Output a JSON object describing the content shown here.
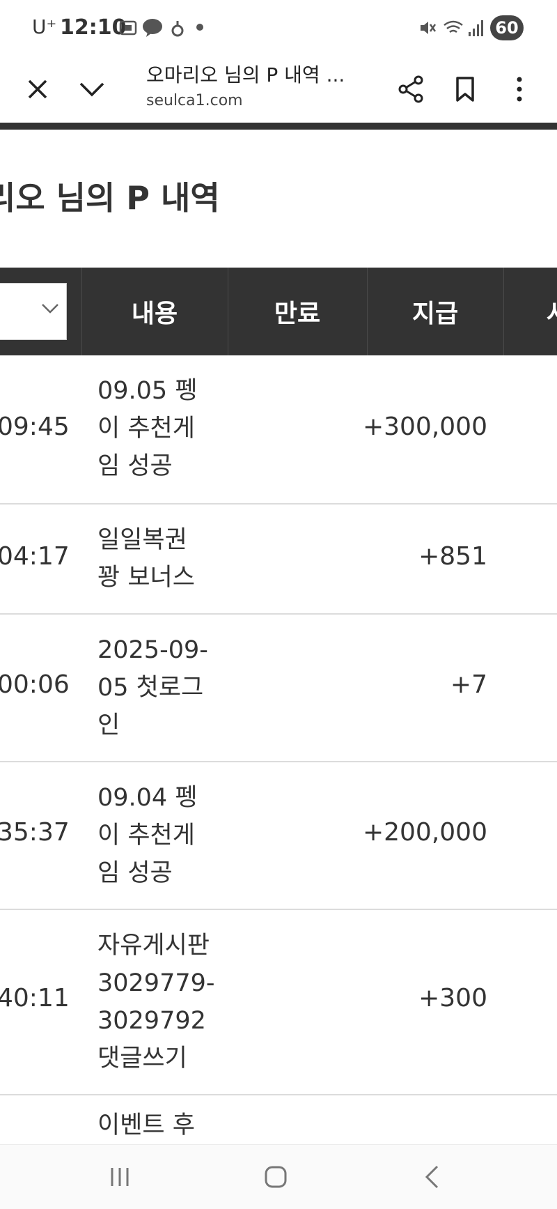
{
  "status_bar": {
    "carrier": "U⁺",
    "time": "12:10",
    "battery": "60"
  },
  "browser": {
    "page_title": "오마리오 님의 P 내역 ...",
    "url": "seulca1.com"
  },
  "page": {
    "heading": "리오 님의 P 내역"
  },
  "table": {
    "headers": [
      "내용",
      "만료",
      "지급",
      "사"
    ],
    "rows": [
      {
        "time": "09:45",
        "lines": [
          "09.05 펭",
          "이 추천게",
          "임 성공"
        ],
        "amount": "+300,000"
      },
      {
        "time": "04:17",
        "lines": [
          "일일복권",
          "꽝 보너스"
        ],
        "amount": "+851"
      },
      {
        "time": "00:06",
        "lines": [
          "2025-09-",
          "05 첫로그",
          "인"
        ],
        "amount": "+7"
      },
      {
        "time": "35:37",
        "lines": [
          "09.04 펭",
          "이 추천게",
          "임 성공"
        ],
        "amount": "+200,000"
      },
      {
        "time": "40:11",
        "lines": [
          "자유게시판",
          "3029779-",
          "3029792",
          "댓글쓰기"
        ],
        "amount": "+300"
      },
      {
        "time": "",
        "lines": [
          "이벤트 후"
        ],
        "amount": ""
      }
    ]
  }
}
